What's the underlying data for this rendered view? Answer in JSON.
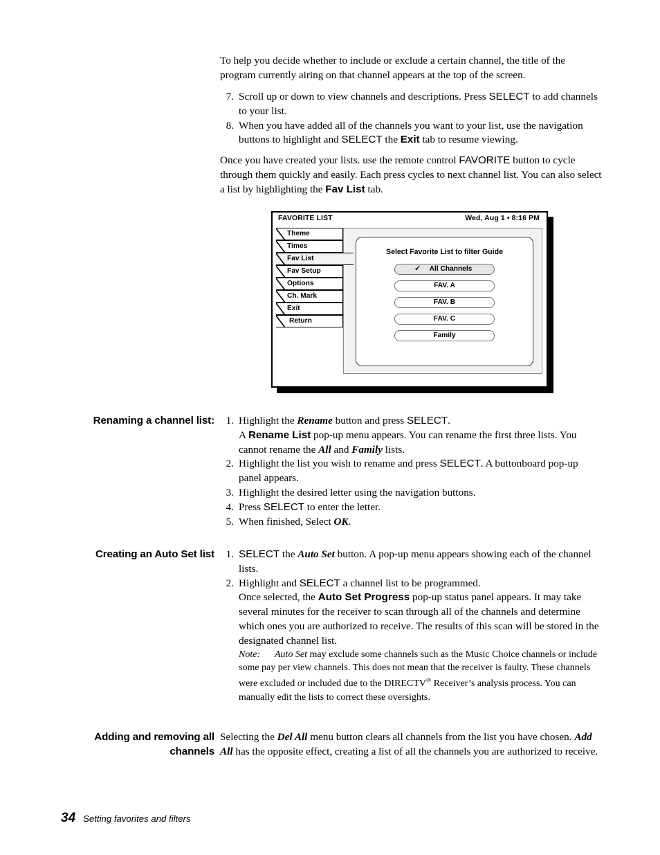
{
  "document": {
    "page_number": "34",
    "footer_text": "Setting favorites and filters"
  },
  "intro": {
    "paragraph": "To help you decide whether to include or exclude a certain channel, the title of the program currently airing on that channel appears at the top of the screen."
  },
  "steps_top": [
    {
      "number": "7.",
      "parts": [
        {
          "text": "Scroll up or down to view channels and descriptions. Press ",
          "style": "normal"
        },
        {
          "text": "SELECT",
          "style": "sans"
        },
        {
          "text": " to add channels to your list.",
          "style": "normal"
        }
      ]
    },
    {
      "number": "8.",
      "parts": [
        {
          "text": "When you have added all of the channels you want to your list, use the navigation buttons to highlight and ",
          "style": "normal"
        },
        {
          "text": "SELECT",
          "style": "sans"
        },
        {
          "text": " the ",
          "style": "normal"
        },
        {
          "text": "Exit",
          "style": "sans-bold"
        },
        {
          "text": " tab to resume viewing.",
          "style": "normal"
        }
      ]
    }
  ],
  "after_steps": {
    "parts": [
      {
        "text": "Once you have created your lists. use the remote control ",
        "style": "normal"
      },
      {
        "text": "FAVORITE",
        "style": "sans"
      },
      {
        "text": " button to cycle through them quickly and easily. Each press cycles to next channel list. You can also select a list by highlighting the ",
        "style": "normal"
      },
      {
        "text": "Fav List",
        "style": "sans-bold"
      },
      {
        "text": " tab.",
        "style": "normal"
      }
    ]
  },
  "figure": {
    "header": {
      "title": "FAVORITE LIST",
      "clock": "Wed, Aug 1  •  8:16 PM"
    },
    "tabs": [
      {
        "label": "Theme",
        "active": false
      },
      {
        "label": "Times",
        "active": false
      },
      {
        "label": "Fav List",
        "active": true
      },
      {
        "label": "Fav Setup",
        "active": false
      },
      {
        "label": "Options",
        "active": false
      },
      {
        "label": "Ch. Mark",
        "active": false
      },
      {
        "label": "Exit",
        "active": false
      },
      {
        "label": "Return",
        "active": false
      }
    ],
    "dialog": {
      "title": "Select Favorite List to filter Guide",
      "buttons": [
        {
          "label": "All Channels",
          "selected": true,
          "check": "✓"
        },
        {
          "label": "FAV. A",
          "selected": false,
          "check": ""
        },
        {
          "label": "FAV. B",
          "selected": false,
          "check": ""
        },
        {
          "label": "FAV. C",
          "selected": false,
          "check": ""
        },
        {
          "label": "Family",
          "selected": false,
          "check": ""
        }
      ]
    }
  },
  "sections": [
    {
      "id": "renaming",
      "heading": "Renaming a channel list:",
      "steps": [
        {
          "number": "1.",
          "lines": [
            [
              {
                "text": "Highlight the ",
                "style": "normal"
              },
              {
                "text": "Rename",
                "style": "bold-italic"
              },
              {
                "text": " button and press ",
                "style": "normal"
              },
              {
                "text": "SELECT",
                "style": "sans"
              },
              {
                "text": ".",
                "style": "normal"
              }
            ],
            [
              {
                "text": "A ",
                "style": "normal"
              },
              {
                "text": "Rename List",
                "style": "sans-bold"
              },
              {
                "text": " pop-up menu appears. You can rename the first three lists. You cannot rename the ",
                "style": "normal"
              },
              {
                "text": "All",
                "style": "bold-italic"
              },
              {
                "text": " and ",
                "style": "normal"
              },
              {
                "text": "Family",
                "style": "bold-italic"
              },
              {
                "text": " lists.",
                "style": "normal"
              }
            ]
          ]
        },
        {
          "number": "2.",
          "lines": [
            [
              {
                "text": "Highlight the list you wish to rename and press ",
                "style": "normal"
              },
              {
                "text": "SELECT",
                "style": "sans"
              },
              {
                "text": ". A buttonboard pop-up panel appears.",
                "style": "normal"
              }
            ]
          ]
        },
        {
          "number": "3.",
          "lines": [
            [
              {
                "text": "Highlight the desired letter using the navigation buttons.",
                "style": "normal"
              }
            ]
          ]
        },
        {
          "number": "4.",
          "lines": [
            [
              {
                "text": "Press ",
                "style": "normal"
              },
              {
                "text": "SELECT",
                "style": "sans"
              },
              {
                "text": " to enter the letter.",
                "style": "normal"
              }
            ]
          ]
        },
        {
          "number": "5.",
          "lines": [
            [
              {
                "text": "When finished, Select ",
                "style": "normal"
              },
              {
                "text": "OK",
                "style": "bold-italic"
              },
              {
                "text": ".",
                "style": "normal"
              }
            ]
          ]
        }
      ]
    },
    {
      "id": "autoset",
      "heading": "Creating an Auto Set list",
      "steps": [
        {
          "number": "1.",
          "lines": [
            [
              {
                "text": "SELECT",
                "style": "sans"
              },
              {
                "text": " the ",
                "style": "normal"
              },
              {
                "text": "Auto Set",
                "style": "bold-italic"
              },
              {
                "text": " button. A pop-up menu appears showing each of the channel lists.",
                "style": "normal"
              }
            ]
          ]
        },
        {
          "number": "2.",
          "lines": [
            [
              {
                "text": "Highlight and ",
                "style": "normal"
              },
              {
                "text": "SELECT",
                "style": "sans"
              },
              {
                "text": " a channel list to be programmed.",
                "style": "normal"
              }
            ],
            [
              {
                "text": "Once selected, the ",
                "style": "normal"
              },
              {
                "text": "Auto Set Progress",
                "style": "sans-bold"
              },
              {
                "text": " pop-up status panel appears. It may take several minutes for the receiver to scan through all of the channels and determine which ones you are authorized to receive. The results of this scan will be stored in the designated channel list.",
                "style": "normal"
              }
            ]
          ]
        }
      ],
      "note": {
        "label": "Note:",
        "parts": [
          {
            "text": "Auto Set",
            "style": "italic"
          },
          {
            "text": " may exclude some channels such as the Music Choice channels or include some pay per view channels. This does not mean that the receiver is faulty. These channels were excluded or included due to the ",
            "style": "normal"
          },
          {
            "text": "DIRECTV",
            "style": "normal"
          },
          {
            "text": "®",
            "style": "sup"
          },
          {
            "text": " Receiver’s analysis process. You can manually edit the lists to correct these oversights.",
            "style": "normal"
          }
        ]
      }
    },
    {
      "id": "addremove",
      "heading_line1": "Adding and removing all",
      "heading_line2": "channels",
      "body_parts": [
        {
          "text": "Selecting the ",
          "style": "normal"
        },
        {
          "text": "Del All",
          "style": "bold-italic"
        },
        {
          "text": " menu button clears all channels from the list you have chosen. ",
          "style": "normal"
        },
        {
          "text": "Add All",
          "style": "bold-italic"
        },
        {
          "text": " has the opposite effect, creating a list of all the channels you are authorized to receive.",
          "style": "normal"
        }
      ]
    }
  ]
}
